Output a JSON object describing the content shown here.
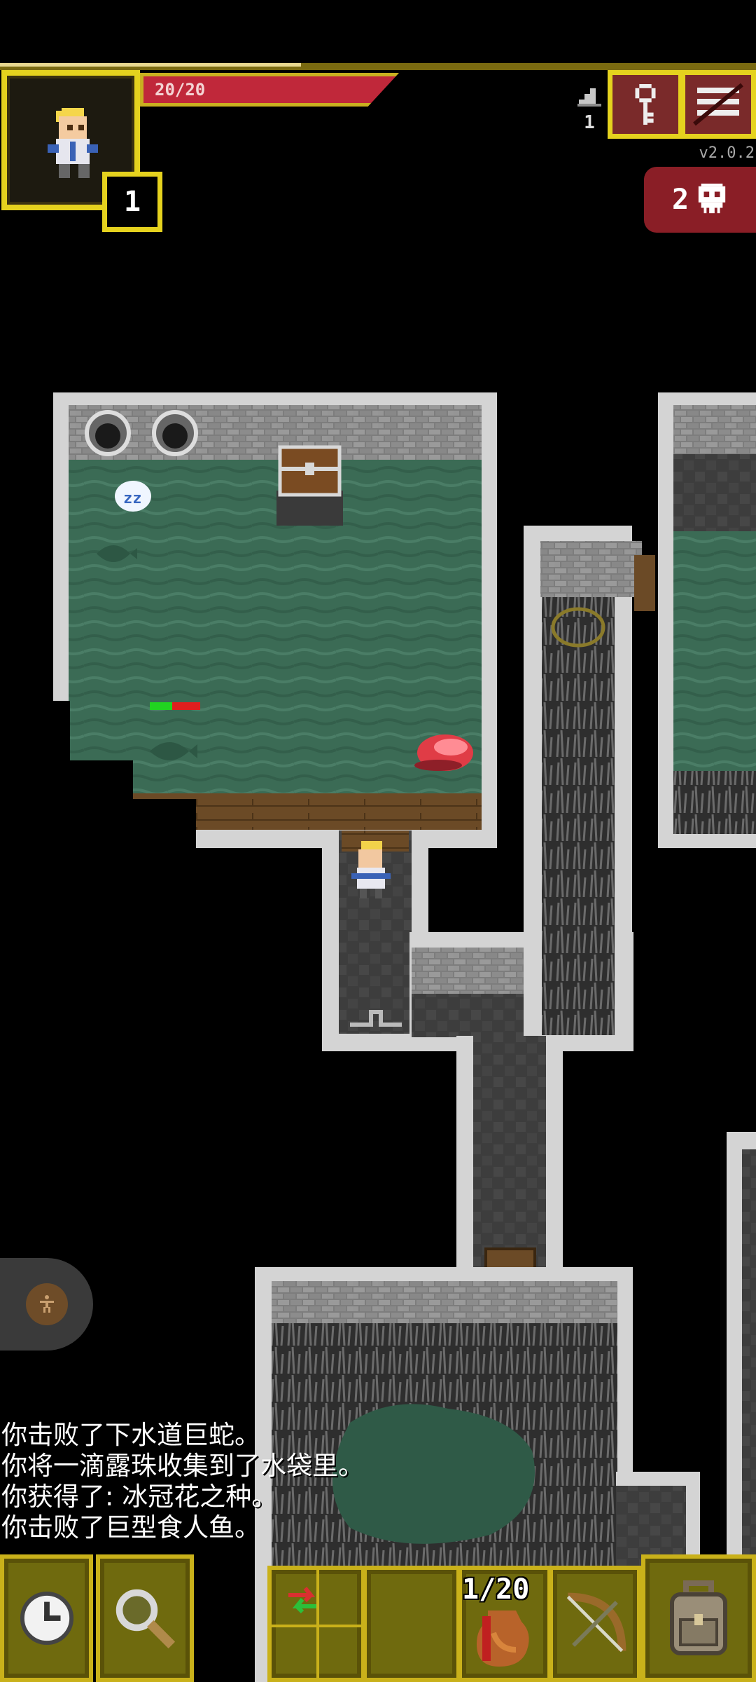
{
  "hud": {
    "hp_text": "20/20",
    "hp_fraction": 1.0,
    "hero_level": "1",
    "depth": "1",
    "version": "v2.0.2",
    "danger_count": "2"
  },
  "icons": {
    "depth": "stairs-icon",
    "journal": "key-icon",
    "menu": "menu-icon",
    "danger": "skull-icon",
    "wait": "clock-icon",
    "search": "magnifier-icon",
    "swap": "swap-arrows-icon",
    "quickslot_1": "waterskin-icon",
    "quickslot_2": "bow-icon",
    "backpack": "backpack-icon"
  },
  "log": [
    "你击败了下水道巨蛇。",
    "你将一滴露珠收集到了水袋里。",
    "你获得了: 冰冠花之种。",
    "你击败了巨型食人鱼。"
  ],
  "toolbar": {
    "quickslot_count": "1/20"
  },
  "colors": {
    "hud_gold": "#e5d21e",
    "hp_red": "#c0283a",
    "danger_red": "#8a1e26",
    "water_green": "#3b6b55",
    "wall_stone": "#c8c8c8"
  }
}
